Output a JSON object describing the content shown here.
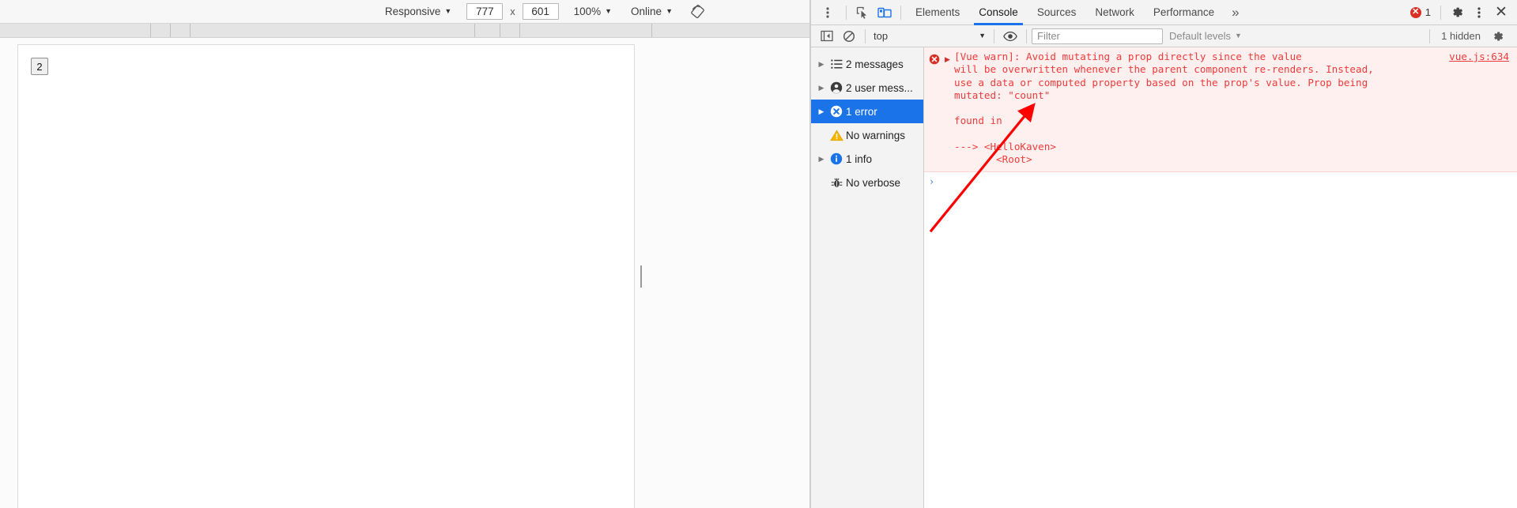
{
  "device_toolbar": {
    "device_label": "Responsive",
    "width_value": "777",
    "height_value": "601",
    "dim_separator": "x",
    "zoom_label": "100%",
    "throttle_label": "Online",
    "rotate_icon": "rotate-device-icon",
    "menu_icon": "kebab-menu-icon"
  },
  "page": {
    "count_button_label": "2",
    "resize_handle": "viewport-resize-handle"
  },
  "devtools": {
    "inspect_icon": "inspect-element-icon",
    "device_toggle_icon": "toggle-device-toolbar-icon",
    "tabs": [
      {
        "label": "Elements",
        "active": false
      },
      {
        "label": "Console",
        "active": true
      },
      {
        "label": "Sources",
        "active": false
      },
      {
        "label": "Network",
        "active": false
      },
      {
        "label": "Performance",
        "active": false
      }
    ],
    "more_tabs_label": "»",
    "error_count": "1",
    "settings_icon": "gear-icon",
    "main_menu_icon": "kebab-menu-icon",
    "close_icon": "close-icon"
  },
  "console_toolbar": {
    "sidebar_toggle_icon": "console-sidebar-toggle-icon",
    "clear_icon": "clear-console-icon",
    "context_label": "top",
    "eye_icon": "live-expression-icon",
    "filter_placeholder": "Filter",
    "filter_value": "",
    "levels_label": "Default levels",
    "hidden_label": "1 hidden",
    "settings_icon": "console-settings-gear-icon"
  },
  "message_sidebar": {
    "items": [
      {
        "label": "2 messages",
        "icon": "list-icon",
        "expandable": true,
        "selected": false
      },
      {
        "label": "2 user mess...",
        "icon": "person-icon",
        "expandable": true,
        "selected": false
      },
      {
        "label": "1 error",
        "icon": "error-icon",
        "expandable": true,
        "selected": true
      },
      {
        "label": "No warnings",
        "icon": "warning-icon",
        "expandable": false,
        "selected": false
      },
      {
        "label": "1 info",
        "icon": "info-icon",
        "expandable": true,
        "selected": false
      },
      {
        "label": "No verbose",
        "icon": "bug-icon",
        "expandable": false,
        "selected": false
      }
    ]
  },
  "console_log": {
    "entry": {
      "icon": "error-circle-icon",
      "expand_icon": "expand-triangle-icon",
      "text": "[Vue warn]: Avoid mutating a prop directly since the value\nwill be overwritten whenever the parent component re-renders. Instead,\nuse a data or computed property based on the prop's value. Prop being\nmutated: \"count\"\n\nfound in\n\n---> <HelloKaven>\n       <Root>",
      "source": "vue.js:634"
    },
    "prompt_symbol": "›"
  },
  "annotation": {
    "arrow": "red-pointer-arrow",
    "color": "#ff0000"
  },
  "colors": {
    "accent": "#1a73e8",
    "error": "#d93025",
    "error_text": "#ef3b3b",
    "error_bg": "#fff0f0",
    "warning": "#f5b400",
    "info": "#1a73e8",
    "toolbar_bg": "#f3f3f3"
  }
}
